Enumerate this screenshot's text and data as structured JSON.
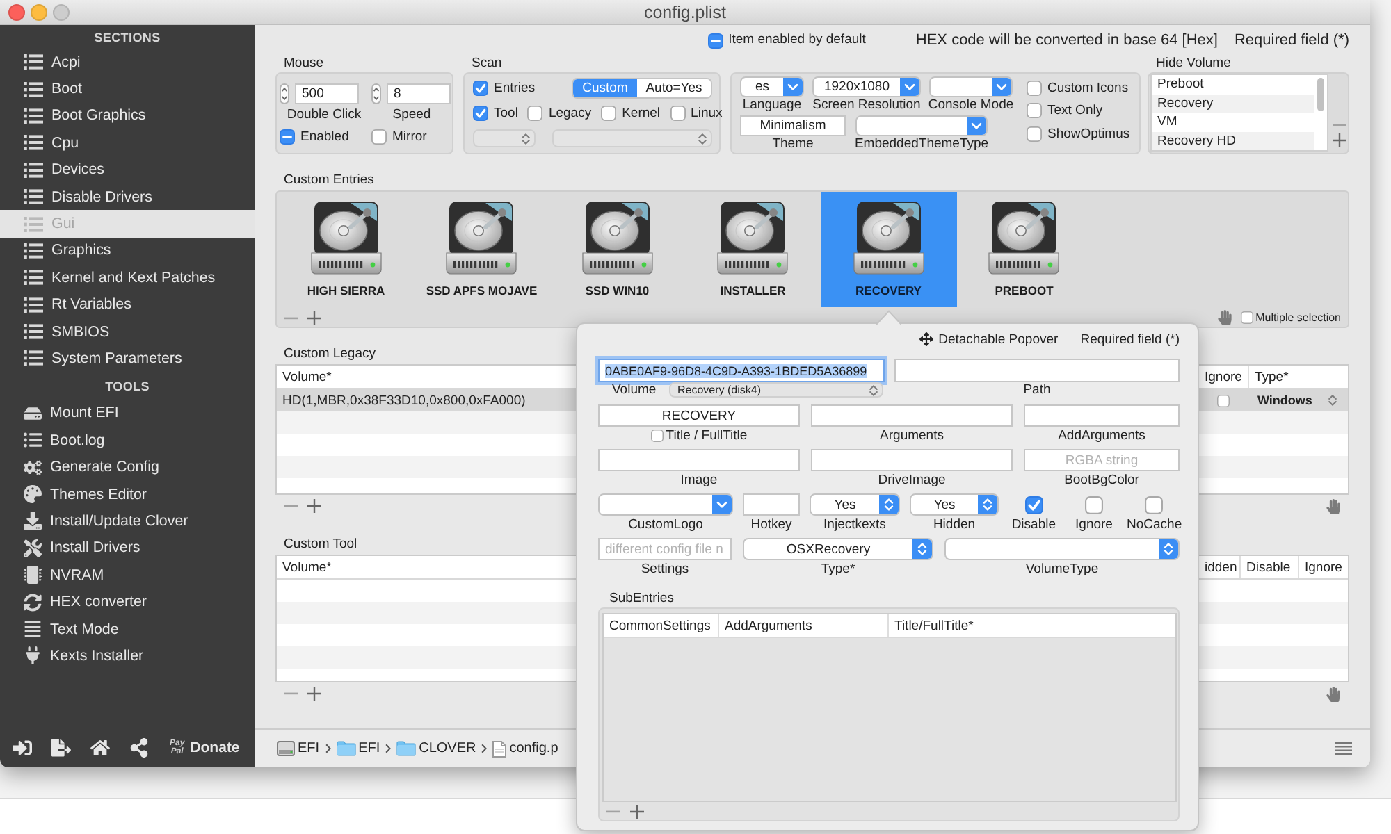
{
  "window": {
    "title": "config.plist"
  },
  "sidebar": {
    "sections_heading": "SECTIONS",
    "sections": [
      {
        "label": "Acpi",
        "selected": false
      },
      {
        "label": "Boot",
        "selected": false
      },
      {
        "label": "Boot Graphics",
        "selected": false
      },
      {
        "label": "Cpu",
        "selected": false
      },
      {
        "label": "Devices",
        "selected": false
      },
      {
        "label": "Disable Drivers",
        "selected": false
      },
      {
        "label": "Gui",
        "selected": true
      },
      {
        "label": "Graphics",
        "selected": false
      },
      {
        "label": "Kernel and Kext Patches",
        "selected": false
      },
      {
        "label": "Rt Variables",
        "selected": false
      },
      {
        "label": "SMBIOS",
        "selected": false
      },
      {
        "label": "System Parameters",
        "selected": false
      }
    ],
    "tools_heading": "TOOLS",
    "tools": [
      {
        "label": "Mount EFI"
      },
      {
        "label": "Boot.log"
      },
      {
        "label": "Generate Config"
      },
      {
        "label": "Themes Editor"
      },
      {
        "label": "Install/Update Clover"
      },
      {
        "label": "Install Drivers"
      },
      {
        "label": "NVRAM"
      },
      {
        "label": "HEX converter"
      },
      {
        "label": "Text Mode"
      },
      {
        "label": "Kexts Installer"
      }
    ],
    "donate": {
      "logo": [
        "Pay",
        "Pal"
      ],
      "label": "Donate"
    }
  },
  "top_bar": {
    "default_enabled": {
      "label": "Item enabled by default",
      "mixed": true
    },
    "hex_note": "HEX code will be converted in base 64 [Hex]",
    "required_note": "Required field (*)"
  },
  "mouse": {
    "label": "Mouse",
    "double_click": {
      "value": "500",
      "label": "Double Click"
    },
    "speed": {
      "value": "8",
      "label": "Speed"
    },
    "enabled": {
      "label": "Enabled",
      "mixed": true
    },
    "mirror": {
      "label": "Mirror",
      "checked": false
    }
  },
  "scan": {
    "label": "Scan",
    "entries": {
      "label": "Entries",
      "checked": true
    },
    "mode": [
      {
        "label": "Custom",
        "selected": true
      },
      {
        "label": "Auto=Yes",
        "selected": false
      }
    ],
    "options": [
      {
        "label": "Tool",
        "checked": true
      },
      {
        "label": "Legacy",
        "checked": false
      },
      {
        "label": "Kernel",
        "checked": false
      },
      {
        "label": "Linux",
        "checked": false
      }
    ],
    "popups": [
      {
        "disabled": true
      },
      {
        "disabled": true
      }
    ]
  },
  "theme_settings": {
    "language": {
      "value": "es",
      "label": "Language"
    },
    "screen_resolution": {
      "value": "1920x1080",
      "label": "Screen Resolution"
    },
    "console_mode": {
      "label": "Console Mode"
    },
    "theme": {
      "value": "Minimalism",
      "label": "Theme"
    },
    "embedded_theme_type": {
      "label": "EmbeddedThemeType"
    },
    "options": [
      {
        "label": "Custom Icons",
        "checked": false
      },
      {
        "label": "Text Only",
        "checked": false
      },
      {
        "label": "ShowOptimus",
        "checked": false
      }
    ]
  },
  "hide_volume": {
    "label": "Hide Volume",
    "items": [
      {
        "label": "Preboot",
        "selected": false
      },
      {
        "label": "Recovery",
        "selected": false
      },
      {
        "label": "VM",
        "selected": false
      },
      {
        "label": "Recovery HD",
        "selected": false
      }
    ]
  },
  "custom_entries": {
    "label": "Custom Entries",
    "entries": [
      {
        "label": "HIGH SIERRA",
        "selected": false
      },
      {
        "label": "SSD APFS MOJAVE",
        "selected": false
      },
      {
        "label": "SSD WIN10",
        "selected": false
      },
      {
        "label": "INSTALLER",
        "selected": false
      },
      {
        "label": "RECOVERY",
        "selected": true
      },
      {
        "label": "PREBOOT",
        "selected": false
      }
    ],
    "multiple_selection": {
      "label": "Multiple selection",
      "checked": false
    }
  },
  "custom_legacy": {
    "label": "Custom Legacy",
    "columns": [
      "Volume*",
      "Ignore",
      "Type*"
    ],
    "rows": [
      {
        "volume": "HD(1,MBR,0x38F33D10,0x800,0xFA000)",
        "ignore": false,
        "type": "Windows",
        "selected": true
      }
    ]
  },
  "custom_tool": {
    "label": "Custom Tool",
    "columns": [
      "Volume*",
      "idden",
      "Disable",
      "Ignore"
    ]
  },
  "path_bar": {
    "segments": [
      {
        "label": "EFI",
        "kind": "disk"
      },
      {
        "label": "EFI",
        "kind": "folder"
      },
      {
        "label": "CLOVER",
        "kind": "folder"
      },
      {
        "label": "config.p",
        "kind": "file"
      }
    ]
  },
  "popover": {
    "title": "Detachable Popover",
    "required_note": "Required field (*)",
    "volume": {
      "value": "0ABE0AF9-96D8-4C9D-A393-1BDED5A36899",
      "focused": true,
      "label": "Volume",
      "disk": "Recovery (disk4)"
    },
    "path": {
      "label": "Path"
    },
    "title_field": {
      "value": "RECOVERY",
      "label": "Title / FullTitle",
      "checked": false
    },
    "arguments": {
      "label": "Arguments"
    },
    "add_arguments": {
      "label": "AddArguments"
    },
    "image": {
      "label": "Image"
    },
    "drive_image": {
      "label": "DriveImage"
    },
    "boot_bg_color": {
      "placeholder": "RGBA string",
      "label": "BootBgColor"
    },
    "custom_logo": {
      "label": "CustomLogo"
    },
    "hotkey": {
      "label": "Hotkey"
    },
    "injectkexts": {
      "value": "Yes",
      "label": "Injectkexts"
    },
    "hidden": {
      "value": "Yes",
      "label": "Hidden"
    },
    "flags": [
      {
        "label": "Disable",
        "checked": true
      },
      {
        "label": "Ignore",
        "checked": false
      },
      {
        "label": "NoCache",
        "checked": false
      }
    ],
    "settings": {
      "placeholder": "different config file n",
      "label": "Settings"
    },
    "type": {
      "value": "OSXRecovery",
      "label": "Type*"
    },
    "volume_type": {
      "label": "VolumeType"
    },
    "subentries": {
      "label": "SubEntries",
      "columns": [
        "CommonSettings",
        "AddArguments",
        "Title/FullTitle*"
      ]
    }
  }
}
